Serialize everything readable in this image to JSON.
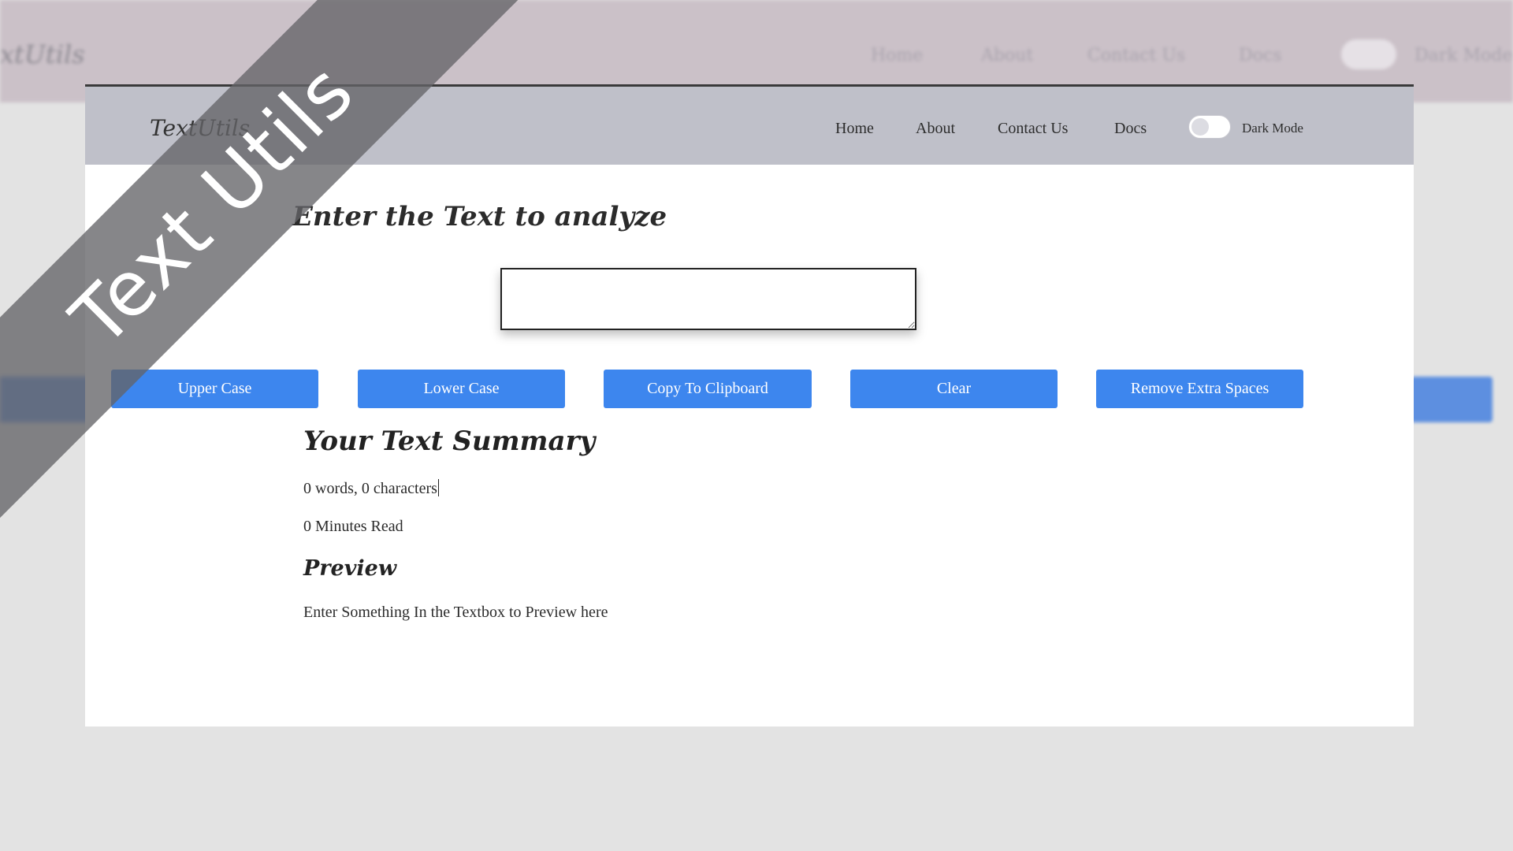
{
  "background": {
    "brand": "xtUtils",
    "nav": [
      "Home",
      "About",
      "Contact Us",
      "Docs"
    ],
    "toggle_label": "Dark Mode"
  },
  "navbar": {
    "brand": "TextUtils",
    "links": [
      "Home",
      "About",
      "Contact Us",
      "Docs"
    ],
    "toggle_label": "Dark Mode"
  },
  "form": {
    "heading": "Enter the Text to analyze",
    "textarea_value": ""
  },
  "buttons": [
    "Upper Case",
    "Lower Case",
    "Copy To Clipboard",
    "Clear",
    "Remove Extra Spaces"
  ],
  "summary": {
    "heading": "Your Text Summary",
    "counts": "0 words, 0 characters",
    "read_time": "0 Minutes Read"
  },
  "preview": {
    "heading": "Preview",
    "text": "Enter Something In the Textbox to Preview here"
  },
  "ribbon": {
    "text": "Text Utils"
  },
  "colors": {
    "navbar_bg": "#bfc0c9",
    "button_bg": "#3d86ee",
    "button_text": "#ffffff",
    "ribbon_bg": "#646468"
  }
}
